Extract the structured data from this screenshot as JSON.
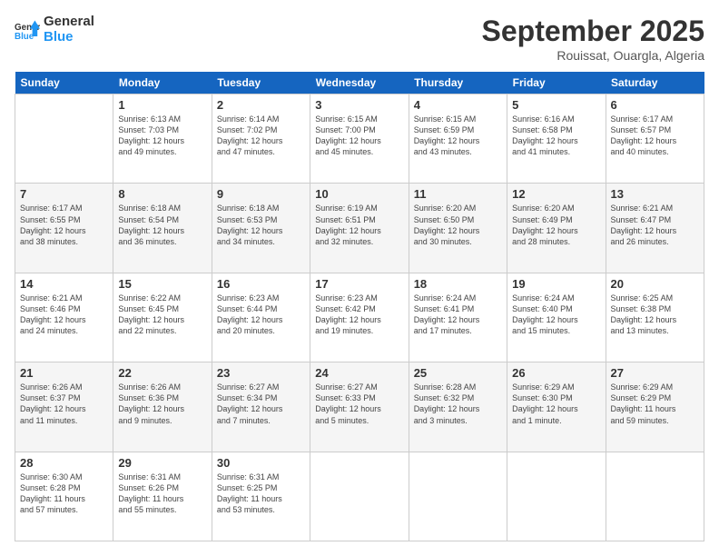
{
  "header": {
    "logo_line1": "General",
    "logo_line2": "Blue",
    "month": "September 2025",
    "location": "Rouissat, Ouargla, Algeria"
  },
  "days_of_week": [
    "Sunday",
    "Monday",
    "Tuesday",
    "Wednesday",
    "Thursday",
    "Friday",
    "Saturday"
  ],
  "weeks": [
    [
      {
        "day": "",
        "info": ""
      },
      {
        "day": "1",
        "info": "Sunrise: 6:13 AM\nSunset: 7:03 PM\nDaylight: 12 hours\nand 49 minutes."
      },
      {
        "day": "2",
        "info": "Sunrise: 6:14 AM\nSunset: 7:02 PM\nDaylight: 12 hours\nand 47 minutes."
      },
      {
        "day": "3",
        "info": "Sunrise: 6:15 AM\nSunset: 7:00 PM\nDaylight: 12 hours\nand 45 minutes."
      },
      {
        "day": "4",
        "info": "Sunrise: 6:15 AM\nSunset: 6:59 PM\nDaylight: 12 hours\nand 43 minutes."
      },
      {
        "day": "5",
        "info": "Sunrise: 6:16 AM\nSunset: 6:58 PM\nDaylight: 12 hours\nand 41 minutes."
      },
      {
        "day": "6",
        "info": "Sunrise: 6:17 AM\nSunset: 6:57 PM\nDaylight: 12 hours\nand 40 minutes."
      }
    ],
    [
      {
        "day": "7",
        "info": "Sunrise: 6:17 AM\nSunset: 6:55 PM\nDaylight: 12 hours\nand 38 minutes."
      },
      {
        "day": "8",
        "info": "Sunrise: 6:18 AM\nSunset: 6:54 PM\nDaylight: 12 hours\nand 36 minutes."
      },
      {
        "day": "9",
        "info": "Sunrise: 6:18 AM\nSunset: 6:53 PM\nDaylight: 12 hours\nand 34 minutes."
      },
      {
        "day": "10",
        "info": "Sunrise: 6:19 AM\nSunset: 6:51 PM\nDaylight: 12 hours\nand 32 minutes."
      },
      {
        "day": "11",
        "info": "Sunrise: 6:20 AM\nSunset: 6:50 PM\nDaylight: 12 hours\nand 30 minutes."
      },
      {
        "day": "12",
        "info": "Sunrise: 6:20 AM\nSunset: 6:49 PM\nDaylight: 12 hours\nand 28 minutes."
      },
      {
        "day": "13",
        "info": "Sunrise: 6:21 AM\nSunset: 6:47 PM\nDaylight: 12 hours\nand 26 minutes."
      }
    ],
    [
      {
        "day": "14",
        "info": "Sunrise: 6:21 AM\nSunset: 6:46 PM\nDaylight: 12 hours\nand 24 minutes."
      },
      {
        "day": "15",
        "info": "Sunrise: 6:22 AM\nSunset: 6:45 PM\nDaylight: 12 hours\nand 22 minutes."
      },
      {
        "day": "16",
        "info": "Sunrise: 6:23 AM\nSunset: 6:44 PM\nDaylight: 12 hours\nand 20 minutes."
      },
      {
        "day": "17",
        "info": "Sunrise: 6:23 AM\nSunset: 6:42 PM\nDaylight: 12 hours\nand 19 minutes."
      },
      {
        "day": "18",
        "info": "Sunrise: 6:24 AM\nSunset: 6:41 PM\nDaylight: 12 hours\nand 17 minutes."
      },
      {
        "day": "19",
        "info": "Sunrise: 6:24 AM\nSunset: 6:40 PM\nDaylight: 12 hours\nand 15 minutes."
      },
      {
        "day": "20",
        "info": "Sunrise: 6:25 AM\nSunset: 6:38 PM\nDaylight: 12 hours\nand 13 minutes."
      }
    ],
    [
      {
        "day": "21",
        "info": "Sunrise: 6:26 AM\nSunset: 6:37 PM\nDaylight: 12 hours\nand 11 minutes."
      },
      {
        "day": "22",
        "info": "Sunrise: 6:26 AM\nSunset: 6:36 PM\nDaylight: 12 hours\nand 9 minutes."
      },
      {
        "day": "23",
        "info": "Sunrise: 6:27 AM\nSunset: 6:34 PM\nDaylight: 12 hours\nand 7 minutes."
      },
      {
        "day": "24",
        "info": "Sunrise: 6:27 AM\nSunset: 6:33 PM\nDaylight: 12 hours\nand 5 minutes."
      },
      {
        "day": "25",
        "info": "Sunrise: 6:28 AM\nSunset: 6:32 PM\nDaylight: 12 hours\nand 3 minutes."
      },
      {
        "day": "26",
        "info": "Sunrise: 6:29 AM\nSunset: 6:30 PM\nDaylight: 12 hours\nand 1 minute."
      },
      {
        "day": "27",
        "info": "Sunrise: 6:29 AM\nSunset: 6:29 PM\nDaylight: 11 hours\nand 59 minutes."
      }
    ],
    [
      {
        "day": "28",
        "info": "Sunrise: 6:30 AM\nSunset: 6:28 PM\nDaylight: 11 hours\nand 57 minutes."
      },
      {
        "day": "29",
        "info": "Sunrise: 6:31 AM\nSunset: 6:26 PM\nDaylight: 11 hours\nand 55 minutes."
      },
      {
        "day": "30",
        "info": "Sunrise: 6:31 AM\nSunset: 6:25 PM\nDaylight: 11 hours\nand 53 minutes."
      },
      {
        "day": "",
        "info": ""
      },
      {
        "day": "",
        "info": ""
      },
      {
        "day": "",
        "info": ""
      },
      {
        "day": "",
        "info": ""
      }
    ]
  ]
}
